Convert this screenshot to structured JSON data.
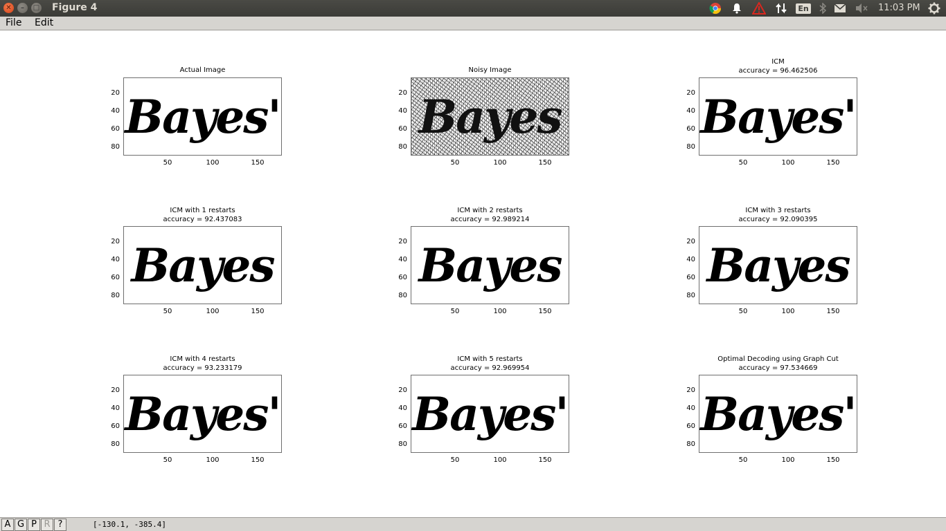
{
  "window": {
    "title": "Figure 4",
    "clock": "11:03 PM",
    "language": "En"
  },
  "menu": {
    "file": "File",
    "edit": "Edit"
  },
  "panels": [
    {
      "title": "Actual Image",
      "subtitle": "",
      "image_text": "Bayes'"
    },
    {
      "title": "Noisy Image",
      "subtitle": "",
      "image_text": "Bayes"
    },
    {
      "title": "ICM",
      "subtitle": "accuracy = 96.462506",
      "image_text": "Bayes'"
    },
    {
      "title": "ICM with 1 restarts",
      "subtitle": "accuracy = 92.437083",
      "image_text": "Bayes"
    },
    {
      "title": "ICM with 2 restarts",
      "subtitle": "accuracy = 92.989214",
      "image_text": "Bayes"
    },
    {
      "title": "ICM with 3 restarts",
      "subtitle": "accuracy = 92.090395",
      "image_text": "Bayes"
    },
    {
      "title": "ICM with 4 restarts",
      "subtitle": "accuracy = 93.233179",
      "image_text": "Bayes'"
    },
    {
      "title": "ICM with 5 restarts",
      "subtitle": "accuracy = 92.969954",
      "image_text": "Bayes'"
    },
    {
      "title": "Optimal Decoding using Graph Cut",
      "subtitle": "accuracy = 97.534669",
      "image_text": "Bayes'"
    }
  ],
  "yticks": [
    "20",
    "40",
    "60",
    "80"
  ],
  "xticks": [
    "50",
    "100",
    "150"
  ],
  "toolbar": {
    "buttons": [
      "A",
      "G",
      "P",
      "R",
      "?"
    ],
    "coords": "[-130.1, -385.4]"
  },
  "colors": {
    "titlebar": "#3b3b37",
    "close_button": "#e25a2a",
    "menubar": "#d6d4d0",
    "alert_icon": "#d9271f"
  }
}
